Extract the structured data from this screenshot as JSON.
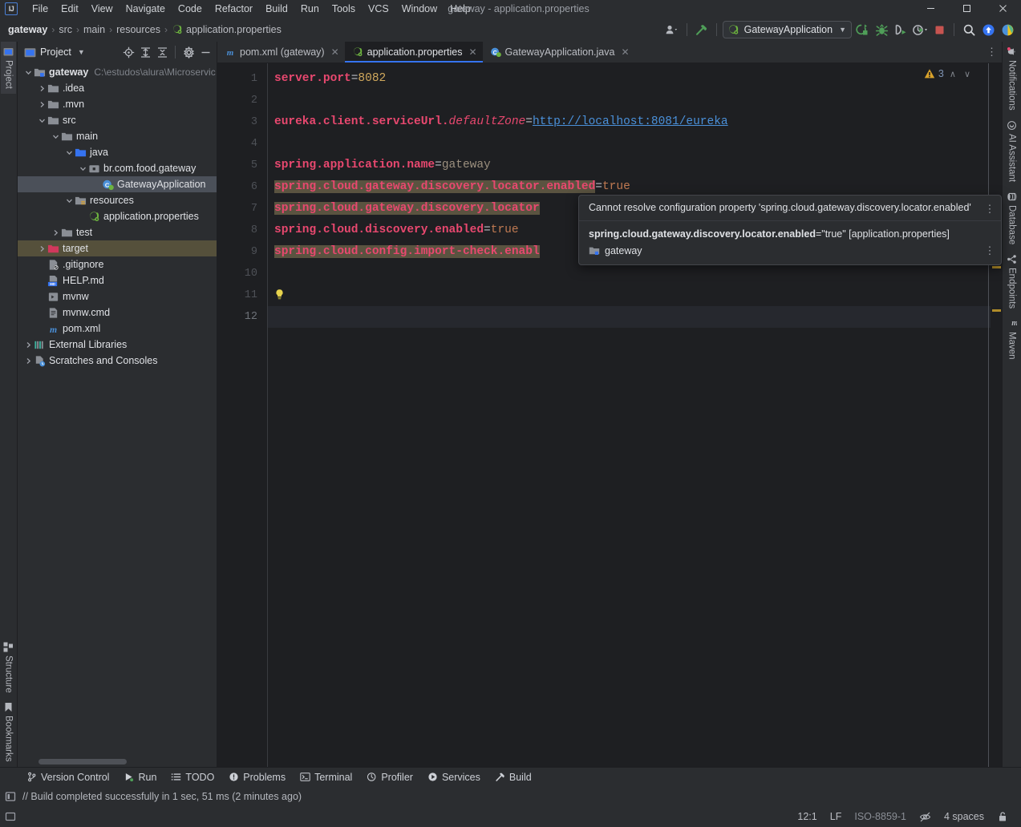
{
  "window": {
    "title": "gateway - application.properties",
    "logo": "intellij-idea-logo",
    "controls": {
      "minimize": "—",
      "maximize": "□",
      "close": "✕"
    }
  },
  "menubar": {
    "items": [
      {
        "label": "File"
      },
      {
        "label": "Edit"
      },
      {
        "label": "View"
      },
      {
        "label": "Navigate"
      },
      {
        "label": "Code"
      },
      {
        "label": "Refactor"
      },
      {
        "label": "Build"
      },
      {
        "label": "Run"
      },
      {
        "label": "Tools"
      },
      {
        "label": "VCS"
      },
      {
        "label": "Window"
      },
      {
        "label": "Help"
      }
    ]
  },
  "navbar": {
    "breadcrumbs": [
      {
        "label": "gateway",
        "bold": true,
        "icon": ""
      },
      {
        "label": "src",
        "bold": false,
        "icon": ""
      },
      {
        "label": "main",
        "bold": false,
        "icon": ""
      },
      {
        "label": "resources",
        "bold": false,
        "icon": ""
      },
      {
        "label": "application.properties",
        "bold": false,
        "icon": "spring-properties-icon"
      }
    ],
    "separator": "›",
    "run_config": "GatewayApplication",
    "buttons": [
      "account-icon",
      "hammer-build-icon",
      "run-icon",
      "debug-icon",
      "run-coverage-icon",
      "profiler-run-icon",
      "stop-icon",
      "search-everywhere-icon",
      "updates-icon",
      "ai-assistant-icon"
    ]
  },
  "stripes": {
    "left_top": [
      {
        "label": "Project",
        "icon": "project-icon",
        "active": true
      }
    ],
    "left_bottom": [
      {
        "label": "Structure",
        "icon": "structure-icon"
      },
      {
        "label": "Bookmarks",
        "icon": "bookmarks-icon"
      }
    ],
    "right": [
      {
        "label": "Notifications",
        "icon": "notifications-icon"
      },
      {
        "label": "AI Assistant",
        "icon": "ai-assistant-icon"
      },
      {
        "label": "Database",
        "icon": "database-icon"
      },
      {
        "label": "Endpoints",
        "icon": "endpoints-icon"
      },
      {
        "label": "Maven",
        "icon": "maven-icon"
      }
    ]
  },
  "project_panel": {
    "title": "Project",
    "tools": [
      "locate-icon",
      "expand-all-icon",
      "collapse-all-icon",
      "settings-gear-icon",
      "hide-icon"
    ],
    "tree": [
      {
        "depth": 0,
        "arrow": "down",
        "icon": "module-folder-icon",
        "label": "gateway",
        "bold": true,
        "path": "C:\\estudos\\alura\\Microservic",
        "state": "normal"
      },
      {
        "depth": 1,
        "arrow": "right",
        "icon": "folder-icon",
        "label": ".idea",
        "bold": false,
        "path": "",
        "state": "normal"
      },
      {
        "depth": 1,
        "arrow": "right",
        "icon": "folder-icon",
        "label": ".mvn",
        "bold": false,
        "path": "",
        "state": "normal"
      },
      {
        "depth": 1,
        "arrow": "down",
        "icon": "folder-icon",
        "label": "src",
        "bold": false,
        "path": "",
        "state": "normal"
      },
      {
        "depth": 2,
        "arrow": "down",
        "icon": "folder-icon",
        "label": "main",
        "bold": false,
        "path": "",
        "state": "normal"
      },
      {
        "depth": 3,
        "arrow": "down",
        "icon": "source-folder-icon",
        "label": "java",
        "bold": false,
        "path": "",
        "state": "normal"
      },
      {
        "depth": 4,
        "arrow": "down",
        "icon": "package-icon",
        "label": "br.com.food.gateway",
        "bold": false,
        "path": "",
        "state": "normal"
      },
      {
        "depth": 5,
        "arrow": "none",
        "icon": "spring-class-icon",
        "label": "GatewayApplication",
        "bold": false,
        "path": "",
        "state": "selected"
      },
      {
        "depth": 3,
        "arrow": "down",
        "icon": "resources-folder-icon",
        "label": "resources",
        "bold": false,
        "path": "",
        "state": "normal"
      },
      {
        "depth": 4,
        "arrow": "none",
        "icon": "spring-properties-icon",
        "label": "application.properties",
        "bold": false,
        "path": "",
        "state": "normal"
      },
      {
        "depth": 2,
        "arrow": "right",
        "icon": "folder-icon",
        "label": "test",
        "bold": false,
        "path": "",
        "state": "normal"
      },
      {
        "depth": 1,
        "arrow": "right",
        "icon": "excluded-folder-icon",
        "label": "target",
        "bold": false,
        "path": "",
        "state": "context"
      },
      {
        "depth": 1,
        "arrow": "none",
        "icon": "gitignore-icon",
        "label": ".gitignore",
        "bold": false,
        "path": "",
        "state": "normal"
      },
      {
        "depth": 1,
        "arrow": "none",
        "icon": "markdown-icon",
        "label": "HELP.md",
        "bold": false,
        "path": "",
        "state": "normal"
      },
      {
        "depth": 1,
        "arrow": "none",
        "icon": "script-icon",
        "label": "mvnw",
        "bold": false,
        "path": "",
        "state": "normal"
      },
      {
        "depth": 1,
        "arrow": "none",
        "icon": "cmd-file-icon",
        "label": "mvnw.cmd",
        "bold": false,
        "path": "",
        "state": "normal"
      },
      {
        "depth": 1,
        "arrow": "none",
        "icon": "maven-pom-icon",
        "label": "pom.xml",
        "bold": false,
        "path": "",
        "state": "normal"
      },
      {
        "depth": 0,
        "arrow": "right",
        "icon": "libraries-icon",
        "label": "External Libraries",
        "bold": false,
        "path": "",
        "state": "normal"
      },
      {
        "depth": 0,
        "arrow": "right",
        "icon": "scratches-icon",
        "label": "Scratches and Consoles",
        "bold": false,
        "path": "",
        "state": "normal"
      }
    ]
  },
  "editor": {
    "tabs": [
      {
        "label": "pom.xml (gateway)",
        "icon": "maven-pom-icon",
        "active": false
      },
      {
        "label": "application.properties",
        "icon": "spring-properties-icon",
        "active": true
      },
      {
        "label": "GatewayApplication.java",
        "icon": "spring-class-icon",
        "active": false
      }
    ],
    "tab_close": "✕",
    "inspections": {
      "icon": "warning-triangle-icon",
      "count": "3",
      "prev": "∧",
      "next": "∨"
    },
    "lines": [
      {
        "no": "1",
        "segments": [
          {
            "t": "server.port",
            "c": "key"
          },
          {
            "t": "=",
            "c": "eq"
          },
          {
            "t": "8082",
            "c": "num"
          }
        ],
        "warn": false,
        "current": false
      },
      {
        "no": "2",
        "segments": [],
        "warn": false,
        "current": false
      },
      {
        "no": "3",
        "segments": [
          {
            "t": "eureka.client.serviceUrl.",
            "c": "key"
          },
          {
            "t": "defaultZone",
            "c": "keyi"
          },
          {
            "t": "=",
            "c": "eq"
          },
          {
            "t": "http://localhost:8081/eureka",
            "c": "link"
          }
        ],
        "warn": false,
        "current": false
      },
      {
        "no": "4",
        "segments": [],
        "warn": false,
        "current": false
      },
      {
        "no": "5",
        "segments": [
          {
            "t": "spring.application.name",
            "c": "key"
          },
          {
            "t": "=",
            "c": "eq"
          },
          {
            "t": "gateway",
            "c": "val"
          }
        ],
        "warn": false,
        "current": false
      },
      {
        "no": "6",
        "segments": [
          {
            "t": "spring.cloud.gateway.discovery.locator.enabled",
            "c": "key",
            "warn": true
          },
          {
            "t": "=",
            "c": "eq"
          },
          {
            "t": "true",
            "c": "val2"
          }
        ],
        "warn": true,
        "current": false
      },
      {
        "no": "7",
        "segments": [
          {
            "t": "spring.cloud.gateway.discovery.locator",
            "c": "key",
            "warn": true
          }
        ],
        "warn": true,
        "current": false
      },
      {
        "no": "8",
        "segments": [
          {
            "t": "spring.cloud.discovery.enabled",
            "c": "key"
          },
          {
            "t": "=",
            "c": "eq"
          },
          {
            "t": "true",
            "c": "val2"
          }
        ],
        "warn": false,
        "current": false
      },
      {
        "no": "9",
        "segments": [
          {
            "t": "spring.cloud.config.import-check.enabl",
            "c": "key",
            "warn": true
          }
        ],
        "warn": true,
        "current": false
      },
      {
        "no": "10",
        "segments": [],
        "warn": false,
        "current": false
      },
      {
        "no": "11",
        "segments": [],
        "warn": false,
        "current": false,
        "bulb": true
      },
      {
        "no": "12",
        "segments": [],
        "warn": false,
        "current": true
      }
    ]
  },
  "tooltip": {
    "message": "Cannot resolve configuration property 'spring.cloud.gateway.discovery.locator.enabled'",
    "property": "spring.cloud.gateway.discovery.locator.enabled",
    "value": "=\"true\" [application.properties]",
    "module": "gateway",
    "module_icon": "module-folder-icon",
    "menu_glyph": "⋮"
  },
  "toolwindow_bar": {
    "items": [
      {
        "label": "Version Control",
        "icon": "vcs-branch-icon"
      },
      {
        "label": "Run",
        "icon": "run-icon"
      },
      {
        "label": "TODO",
        "icon": "todo-icon"
      },
      {
        "label": "Problems",
        "icon": "problems-icon"
      },
      {
        "label": "Terminal",
        "icon": "terminal-icon"
      },
      {
        "label": "Profiler",
        "icon": "profiler-icon"
      },
      {
        "label": "Services",
        "icon": "services-icon"
      },
      {
        "label": "Build",
        "icon": "build-hammer-icon"
      }
    ]
  },
  "build_status": {
    "icon": "build-status-icon",
    "text": "// Build completed successfully in 1 sec, 51 ms (2 minutes ago)"
  },
  "statusbar": {
    "left_icon": "memory-indicator-icon",
    "right": [
      {
        "label": "12:1",
        "name": "caret-position"
      },
      {
        "label": "LF",
        "name": "line-separator"
      },
      {
        "label": "ISO-8859-1",
        "name": "file-encoding",
        "dim": true
      },
      {
        "label": "",
        "name": "reader-mode-icon",
        "icon": true
      },
      {
        "label": "4 spaces",
        "name": "indent-setting"
      },
      {
        "label": "",
        "name": "lock-icon",
        "icon": true
      }
    ]
  },
  "colors": {
    "bg_panel": "#2b2d30",
    "bg_editor": "#1e1f22",
    "accent_blue": "#3573f0",
    "selection": "#4b5059",
    "warn_highlight": "#5a5340",
    "key_pink": "#e8486f",
    "link_blue": "#4a90d9",
    "number_gold": "#d0a85c"
  }
}
